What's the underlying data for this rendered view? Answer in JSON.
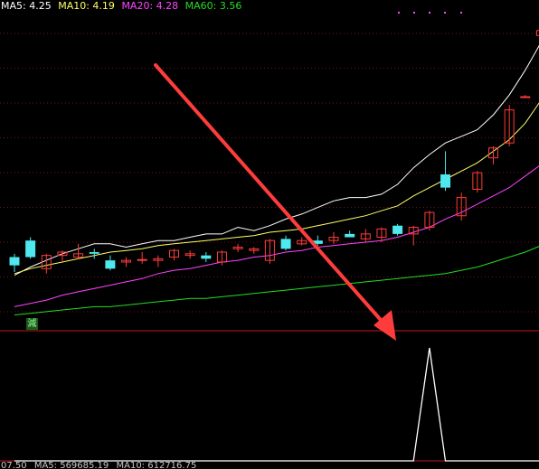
{
  "legend": {
    "ma5": {
      "text": "MA5: 4.25",
      "color": "#ffffff"
    },
    "ma10": {
      "text": "MA10: 4.19",
      "color": "#ffff66"
    },
    "ma20": {
      "text": "MA20: 4.28",
      "color": "#ff44ff"
    },
    "ma60": {
      "text": "MA60: 3.56",
      "color": "#22dd22"
    }
  },
  "volume_legend": {
    "value": "07.50",
    "ma5": "MA5: 569685.19",
    "ma10": "MA10: 612716.75"
  },
  "badge": {
    "label": "減",
    "color": "#1c5d1c"
  },
  "colors": {
    "up": "#ff3b3b",
    "down": "#4ee8ee",
    "grid": "#7a1010",
    "separator": "#c01818",
    "arrow": "#ff3c3c",
    "indicator": "#ffffff"
  },
  "chart_data": [
    {
      "type": "candlestick",
      "title": "",
      "series": [
        {
          "name": "MA5",
          "color": "#ffffff",
          "values": [
            3.37,
            3.42,
            3.46,
            3.5,
            3.53,
            3.56,
            3.56,
            3.54,
            3.56,
            3.58,
            3.58,
            3.6,
            3.62,
            3.62,
            3.66,
            3.64,
            3.67,
            3.71,
            3.74,
            3.78,
            3.82,
            3.84,
            3.84,
            3.86,
            3.92,
            4.02,
            4.1,
            4.17,
            4.21,
            4.25,
            4.34,
            4.46,
            4.61,
            4.78
          ]
        },
        {
          "name": "MA10",
          "color": "#ffff66",
          "values": [
            3.38,
            3.41,
            3.43,
            3.45,
            3.47,
            3.49,
            3.51,
            3.52,
            3.53,
            3.55,
            3.56,
            3.57,
            3.58,
            3.59,
            3.6,
            3.61,
            3.63,
            3.64,
            3.65,
            3.67,
            3.69,
            3.71,
            3.73,
            3.76,
            3.79,
            3.85,
            3.9,
            3.95,
            4.0,
            4.05,
            4.12,
            4.19,
            4.29,
            4.43
          ]
        },
        {
          "name": "MA20",
          "color": "#ff44ff",
          "values": [
            3.18,
            3.2,
            3.22,
            3.25,
            3.27,
            3.29,
            3.31,
            3.33,
            3.35,
            3.38,
            3.4,
            3.41,
            3.43,
            3.45,
            3.46,
            3.48,
            3.49,
            3.51,
            3.52,
            3.54,
            3.55,
            3.56,
            3.57,
            3.58,
            3.6,
            3.63,
            3.66,
            3.71,
            3.75,
            3.8,
            3.85,
            3.9,
            3.97,
            4.04
          ]
        },
        {
          "name": "MA60",
          "color": "#22dd22",
          "values": [
            3.13,
            3.14,
            3.15,
            3.16,
            3.17,
            3.18,
            3.18,
            3.19,
            3.2,
            3.21,
            3.22,
            3.23,
            3.23,
            3.24,
            3.25,
            3.26,
            3.27,
            3.28,
            3.29,
            3.3,
            3.31,
            3.32,
            3.33,
            3.34,
            3.35,
            3.36,
            3.37,
            3.38,
            3.4,
            3.42,
            3.45,
            3.48,
            3.51,
            3.55
          ]
        }
      ],
      "candles": [
        {
          "o": 3.48,
          "h": 3.5,
          "l": 3.39,
          "c": 3.43
        },
        {
          "o": 3.58,
          "h": 3.6,
          "l": 3.47,
          "c": 3.48
        },
        {
          "o": 3.41,
          "h": 3.5,
          "l": 3.38,
          "c": 3.49
        },
        {
          "o": 3.49,
          "h": 3.52,
          "l": 3.45,
          "c": 3.51
        },
        {
          "o": 3.48,
          "h": 3.56,
          "l": 3.47,
          "c": 3.5
        },
        {
          "o": 3.51,
          "h": 3.53,
          "l": 3.47,
          "c": 3.5
        },
        {
          "o": 3.46,
          "h": 3.49,
          "l": 3.4,
          "c": 3.41
        },
        {
          "o": 3.45,
          "h": 3.48,
          "l": 3.42,
          "c": 3.46
        },
        {
          "o": 3.46,
          "h": 3.51,
          "l": 3.44,
          "c": 3.465
        },
        {
          "o": 3.46,
          "h": 3.49,
          "l": 3.42,
          "c": 3.47
        },
        {
          "o": 3.48,
          "h": 3.53,
          "l": 3.46,
          "c": 3.52
        },
        {
          "o": 3.49,
          "h": 3.52,
          "l": 3.47,
          "c": 3.5
        },
        {
          "o": 3.49,
          "h": 3.51,
          "l": 3.45,
          "c": 3.47
        },
        {
          "o": 3.45,
          "h": 3.52,
          "l": 3.43,
          "c": 3.51
        },
        {
          "o": 3.53,
          "h": 3.56,
          "l": 3.51,
          "c": 3.54
        },
        {
          "o": 3.52,
          "h": 3.54,
          "l": 3.5,
          "c": 3.53
        },
        {
          "o": 3.46,
          "h": 3.59,
          "l": 3.44,
          "c": 3.58
        },
        {
          "o": 3.59,
          "h": 3.61,
          "l": 3.52,
          "c": 3.53
        },
        {
          "o": 3.56,
          "h": 3.6,
          "l": 3.55,
          "c": 3.58
        },
        {
          "o": 3.58,
          "h": 3.61,
          "l": 3.55,
          "c": 3.56
        },
        {
          "o": 3.58,
          "h": 3.63,
          "l": 3.56,
          "c": 3.6
        },
        {
          "o": 3.62,
          "h": 3.64,
          "l": 3.6,
          "c": 3.6
        },
        {
          "o": 3.59,
          "h": 3.65,
          "l": 3.57,
          "c": 3.62
        },
        {
          "o": 3.6,
          "h": 3.66,
          "l": 3.57,
          "c": 3.65
        },
        {
          "o": 3.67,
          "h": 3.68,
          "l": 3.61,
          "c": 3.62
        },
        {
          "o": 3.62,
          "h": 3.67,
          "l": 3.55,
          "c": 3.66
        },
        {
          "o": 3.66,
          "h": 3.76,
          "l": 3.64,
          "c": 3.75
        },
        {
          "o": 3.98,
          "h": 4.12,
          "l": 3.88,
          "c": 3.9
        },
        {
          "o": 3.73,
          "h": 3.87,
          "l": 3.7,
          "c": 3.84
        },
        {
          "o": 3.89,
          "h": 4.0,
          "l": 3.87,
          "c": 3.99
        },
        {
          "o": 4.08,
          "h": 4.15,
          "l": 4.04,
          "c": 4.14
        },
        {
          "o": 4.17,
          "h": 4.4,
          "l": 4.15,
          "c": 4.37
        },
        {
          "o": 4.45,
          "h": 4.46,
          "l": 4.45,
          "c": 4.45
        },
        {
          "o": 4.82,
          "h": 4.86,
          "l": 4.78,
          "c": 4.85
        }
      ],
      "ylim": [
        3.04,
        4.98
      ]
    },
    {
      "type": "line",
      "title": "",
      "series": [
        {
          "name": "",
          "color": "#ffffff",
          "values": [
            0,
            0,
            0,
            0,
            0,
            0,
            0,
            0,
            0,
            0,
            0,
            0,
            0,
            0,
            0,
            0,
            0,
            0,
            0,
            0,
            0,
            0,
            0,
            0,
            0,
            0,
            1,
            0,
            0,
            0,
            0,
            0,
            0,
            0
          ]
        }
      ],
      "ylim": [
        0,
        1
      ]
    }
  ]
}
